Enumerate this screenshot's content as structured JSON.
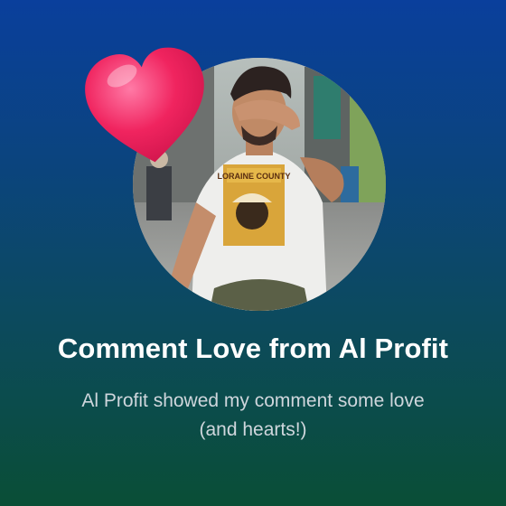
{
  "card": {
    "title": "Comment Love from Al Profit",
    "subtitle_line1": "Al Profit showed my comment some love",
    "subtitle_line2": "(and hearts!)"
  },
  "avatar": {
    "alt": "Al Profit",
    "tshirt_text": "LORAINE COUNTY"
  },
  "icons": {
    "badge": "heart-icon"
  },
  "colors": {
    "background_top": "#0a3f9c",
    "background_bottom": "#0a4e36",
    "heart": "#f0245f",
    "title": "#ffffff",
    "subtitle": "#cfd6dc"
  }
}
